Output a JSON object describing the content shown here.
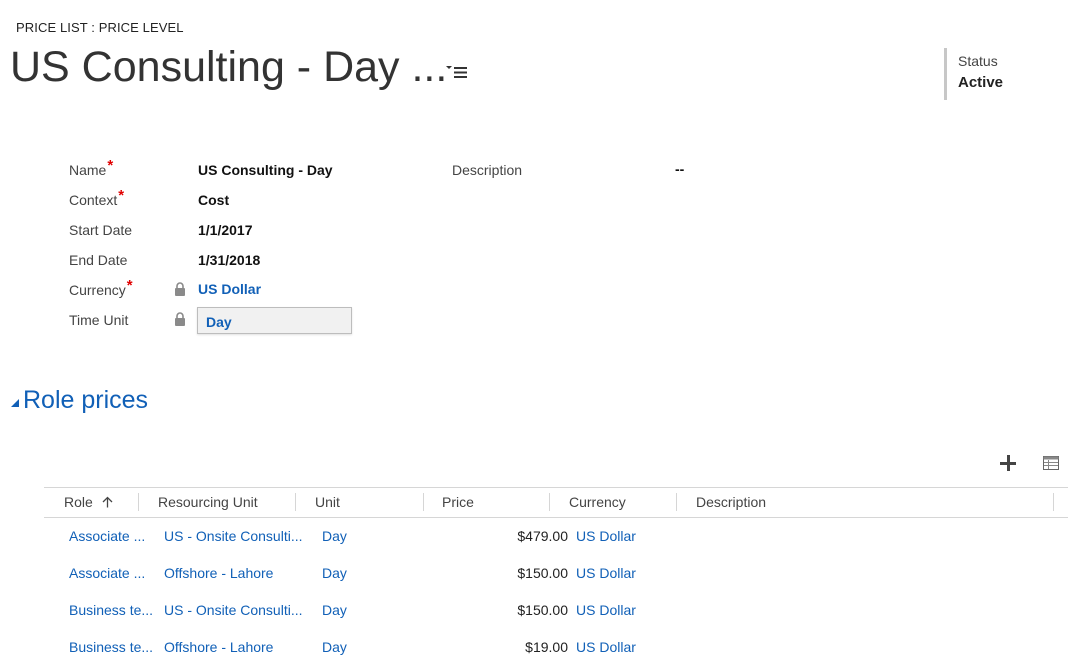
{
  "header": {
    "entity_type": "PRICE LIST : PRICE LEVEL",
    "title": "US Consulting - Day ...",
    "status_label": "Status",
    "status_value": "Active"
  },
  "form": {
    "name_label": "Name",
    "name_value": "US Consulting - Day",
    "context_label": "Context",
    "context_value": "Cost",
    "start_date_label": "Start Date",
    "start_date_value": "1/1/2017",
    "end_date_label": "End Date",
    "end_date_value": "1/31/2018",
    "currency_label": "Currency",
    "currency_value": "US Dollar",
    "time_unit_label": "Time Unit",
    "time_unit_value": "Day",
    "description_label": "Description",
    "description_value": "--",
    "required_marker": "*"
  },
  "section": {
    "title": "Role prices"
  },
  "grid": {
    "columns": [
      "Role",
      "Resourcing Unit",
      "Unit",
      "Price",
      "Currency",
      "Description"
    ],
    "rows": [
      {
        "role": "Associate ...",
        "resourcing_unit": "US - Onsite Consulti...",
        "unit": "Day",
        "price": "$479.00",
        "currency": "US Dollar",
        "description": ""
      },
      {
        "role": "Associate ...",
        "resourcing_unit": "Offshore - Lahore",
        "unit": "Day",
        "price": "$150.00",
        "currency": "US Dollar",
        "description": ""
      },
      {
        "role": "Business te...",
        "resourcing_unit": "US - Onsite Consulti...",
        "unit": "Day",
        "price": "$150.00",
        "currency": "US Dollar",
        "description": ""
      },
      {
        "role": "Business te...",
        "resourcing_unit": "Offshore - Lahore",
        "unit": "Day",
        "price": "$19.00",
        "currency": "US Dollar",
        "description": ""
      }
    ]
  },
  "icons": {
    "title_menu": "menu-lines-icon",
    "lock": "lock-icon",
    "section_toggle": "triangle-icon",
    "add": "plus-icon",
    "grid_view": "grid-view-icon",
    "sort": "sort-up-arrow-icon"
  },
  "colors": {
    "link": "#1160b7",
    "required": "#e00000",
    "text": "#333333"
  }
}
